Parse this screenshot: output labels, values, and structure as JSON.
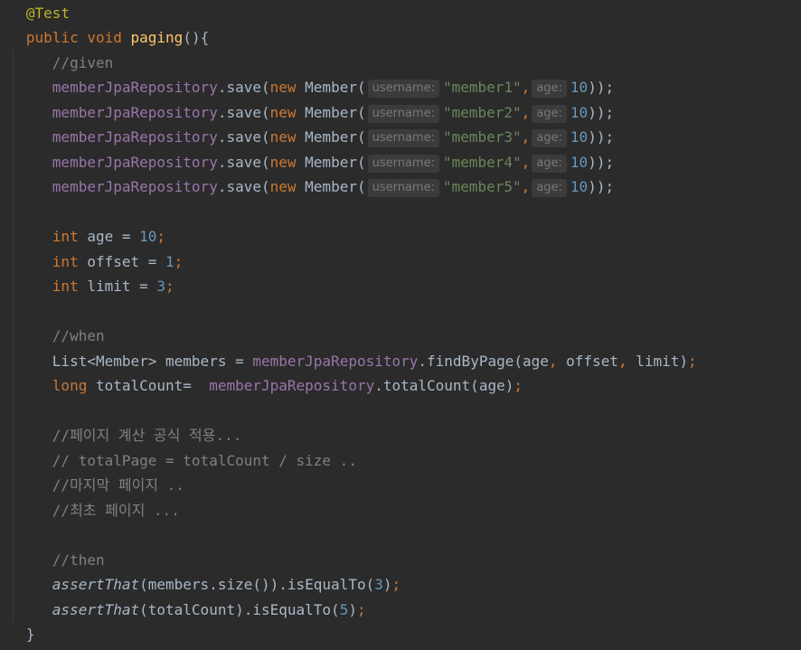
{
  "code": {
    "annotation": "@Test",
    "kw_public": "public",
    "kw_void": "void",
    "method_name": "paging",
    "open_sig": "(){",
    "comment_given": "//given",
    "repo": "memberJpaRepository",
    "dot_save": ".save(",
    "kw_new": "new",
    "member_ctor": " Member(",
    "hint_username": "username:",
    "hint_age": "age:",
    "comma": ",",
    "age_val": "10",
    "close_call": "));",
    "members": [
      "\"member1\"",
      "\"member2\"",
      "\"member3\"",
      "\"member4\"",
      "\"member5\""
    ],
    "kw_int": "int",
    "decl_age": " age = ",
    "decl_offset": " offset = ",
    "decl_limit": " limit = ",
    "val_age": "10",
    "val_offset": "1",
    "val_limit": "3",
    "semi": ";",
    "comment_when": "//when",
    "list_decl": "List<Member> members = ",
    "find_call": ".findByPage(age",
    "offset_arg": " offset",
    "limit_arg": " limit)",
    "kw_long": "long",
    "total_decl": " totalCount=  ",
    "total_call": ".totalCount(age)",
    "comment_1": "//페이지 계산 공식 적용...",
    "comment_2": "// totalPage = totalCount / size ..",
    "comment_3": "//마지막 페이지 ..",
    "comment_4": "//최초 페이지 ...",
    "comment_then": "//then",
    "assert_fn": "assertThat",
    "assert1_arg": "(members.size()).isEqualTo(",
    "assert1_val": "3",
    "assert2_arg": "(totalCount).isEqualTo(",
    "assert2_val": "5",
    "close_paren": ")",
    "closing_brace": "}"
  }
}
